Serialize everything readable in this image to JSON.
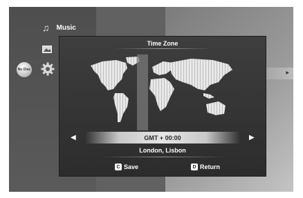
{
  "menu": {
    "music_label": "Music",
    "music_icon": "music-note-icon",
    "photo_icon": "photo-icon",
    "settings_icon": "gear-icon",
    "disc_label": "No Disc"
  },
  "dialog": {
    "title": "Time Zone",
    "gmt_value": "GMT + 00:00",
    "city": "London, Lisbon",
    "left_arrow": "◀",
    "right_arrow": "▶",
    "save_key": "C",
    "save_label": "Save",
    "return_key": "D",
    "return_label": "Return"
  },
  "colors": {
    "dialog_bg": "#2c2c2c",
    "map_land": "#e8e8e8",
    "selected_zone": "#7a7a7a"
  }
}
